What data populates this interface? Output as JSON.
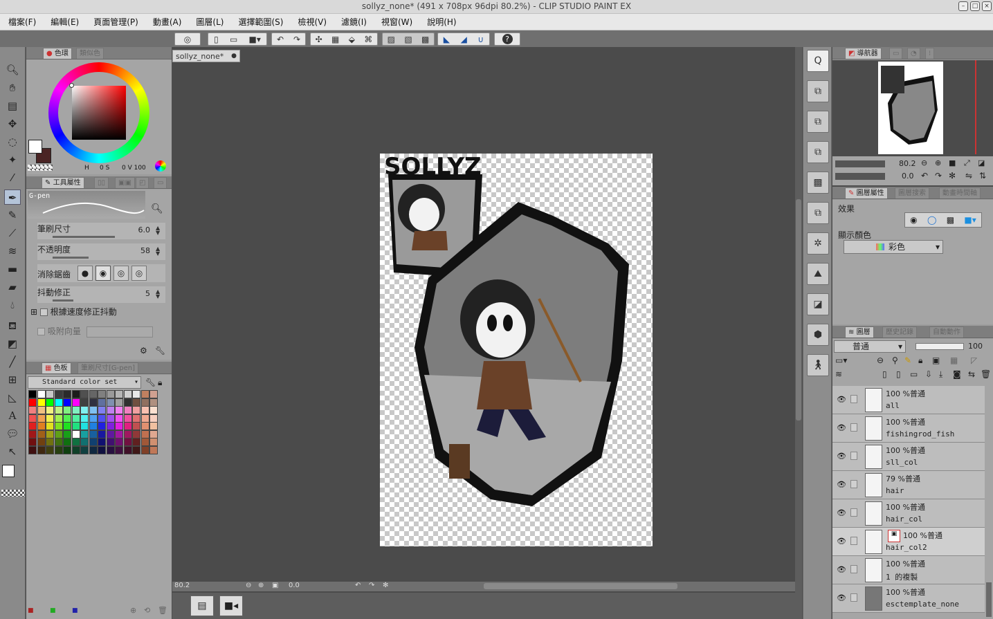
{
  "window": {
    "title": "sollyz_none* (491 x 708px 96dpi 80.2%)  - CLIP STUDIO PAINT EX"
  },
  "menu": [
    "檔案(F)",
    "編輯(E)",
    "頁面管理(P)",
    "動畫(A)",
    "圖層(L)",
    "選擇範圍(S)",
    "檢視(V)",
    "濾鏡(I)",
    "視窗(W)",
    "說明(H)"
  ],
  "color_panel": {
    "tab_label": "色環",
    "tab2_label": "類似色",
    "hsv_h": "H",
    "hsv_s": "0 S",
    "hsv_v": "0 V 100"
  },
  "tool_props": {
    "tab_label": "工具屬性",
    "brush_name": "G-pen",
    "size_label": "筆刷尺寸",
    "size_value": "6.0",
    "opacity_label": "不透明度",
    "opacity_value": "58",
    "aa_label": "消除鋸齒",
    "stab_label": "抖動修正",
    "stab_value": "5",
    "speed_label": "根據速度修正抖動",
    "snap_label": "吸附向量"
  },
  "color_set": {
    "tab_label": "色板",
    "tab2_label": "筆刷尺寸[G-pen]",
    "set_name": "Standard color set"
  },
  "document": {
    "tab_label": "sollyz_none*",
    "art_title": "SOLLYZ"
  },
  "status": {
    "zoom": "80.2",
    "angle": "0.0"
  },
  "navigator": {
    "tab_label": "導航器",
    "zoom": "80.2",
    "rotate": "0.0"
  },
  "layer_props": {
    "tab_label": "圖層屬性",
    "tab2_label": "圖層搜索",
    "tab3_label": "動畫時間軸",
    "effect_label": "效果",
    "display_color_label": "顯示顏色",
    "display_color_value": "彩色"
  },
  "layers": {
    "tab_label": "圖層",
    "tab2_label": "歷史記錄",
    "tab3_label": "自動動作",
    "blend_mode": "普通",
    "opacity": "100",
    "items": [
      {
        "pct": "100 %普通",
        "name": "all"
      },
      {
        "pct": "100 %普通",
        "name": "fishingrod_fish"
      },
      {
        "pct": "100 %普通",
        "name": "sll_col"
      },
      {
        "pct": "79 %普通",
        "name": "hair"
      },
      {
        "pct": "100 %普通",
        "name": "hair_col"
      },
      {
        "pct": "100 %普通",
        "name": "hair_col2"
      },
      {
        "pct": "100 %普通",
        "name": "1 的複製"
      },
      {
        "pct": "100 %普通",
        "name": "esctemplate_none"
      }
    ]
  },
  "palette": {
    "main": "#ffffff",
    "sub": "#4a2424",
    "swatch_rows": [
      [
        "#000000",
        "#ffffff",
        "#c8c8c8",
        "#3a3a3a",
        "#2a2a2a",
        "#1c1c1c",
        "#505050",
        "#666666",
        "#808080",
        "#9a9a9a",
        "#b4b4b4",
        "#cfcfcf",
        "#e8e8e8",
        "#c08060",
        "#d0a090"
      ],
      [
        "#ff0000",
        "#ffff00",
        "#00ff00",
        "#00ffff",
        "#0000ff",
        "#ff00ff",
        "#404040",
        "#303040",
        "#6070a0",
        "#8090b0",
        "#a0a0a0",
        "#303030",
        "#705040",
        "#907060",
        "#b09080"
      ],
      [
        "#f08080",
        "#f0c080",
        "#f0f080",
        "#c0f080",
        "#80f080",
        "#80f0c0",
        "#80f0f0",
        "#80c0f0",
        "#8080f0",
        "#c080f0",
        "#f080f0",
        "#f080c0",
        "#f0a0a0",
        "#f8c0b0",
        "#fce0d0"
      ],
      [
        "#f05050",
        "#f0a050",
        "#f0f050",
        "#a0f050",
        "#50f050",
        "#50f0a0",
        "#50f0f0",
        "#50a0f0",
        "#5050f0",
        "#a050f0",
        "#f050f0",
        "#f050a0",
        "#e07070",
        "#f0a890",
        "#f8d0c0"
      ],
      [
        "#e02020",
        "#e08020",
        "#e0e020",
        "#80e020",
        "#20e020",
        "#20e080",
        "#20e0e0",
        "#2080e0",
        "#2020e0",
        "#8020e0",
        "#e020e0",
        "#e02080",
        "#c05050",
        "#e09070",
        "#f0c0a0"
      ],
      [
        "#a01818",
        "#a06018",
        "#a0a018",
        "#60a018",
        "#18a018",
        "#ffffff",
        "#18a0a0",
        "#1860a0",
        "#1818a0",
        "#6018a0",
        "#a018a0",
        "#a01860",
        "#903838",
        "#c07050",
        "#e0a890"
      ],
      [
        "#701010",
        "#704010",
        "#707010",
        "#407010",
        "#107010",
        "#107040",
        "#107070",
        "#104070",
        "#101070",
        "#401070",
        "#701070",
        "#701040",
        "#602020",
        "#a05838",
        "#d09070"
      ],
      [
        "#401010",
        "#402810",
        "#404010",
        "#284010",
        "#104010",
        "#104028",
        "#104040",
        "#102840",
        "#101040",
        "#281040",
        "#401040",
        "#401028",
        "#401818",
        "#804028",
        "#c07858"
      ]
    ]
  }
}
